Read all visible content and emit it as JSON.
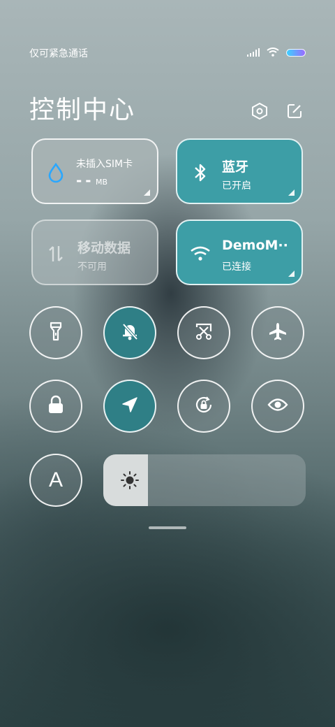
{
  "status_bar": {
    "carrier_text": "仅可紧急通话",
    "icons": [
      "signal-icon",
      "wifi-icon",
      "battery-icon"
    ]
  },
  "header": {
    "title": "控制中心",
    "actions": [
      "settings-icon",
      "edit-icon"
    ]
  },
  "tiles": {
    "data_usage": {
      "title": "未插入SIM卡",
      "value": "- -",
      "unit": "MB",
      "icon": "water-drop-icon"
    },
    "bluetooth": {
      "title": "蓝牙",
      "status": "已开启",
      "icon": "bluetooth-icon"
    },
    "mobile_data": {
      "title": "移动数据",
      "status": "不可用",
      "icon": "data-arrows-icon"
    },
    "wifi": {
      "title": "DemoM··",
      "status": "已连接",
      "icon": "wifi-icon"
    }
  },
  "toggles": [
    {
      "name": "flashlight",
      "icon": "flashlight-icon",
      "state": "off"
    },
    {
      "name": "mute",
      "icon": "bell-off-icon",
      "state": "on"
    },
    {
      "name": "screenshot",
      "icon": "scissors-icon",
      "state": "off"
    },
    {
      "name": "airplane",
      "icon": "airplane-icon",
      "state": "off"
    },
    {
      "name": "lock",
      "icon": "lock-icon",
      "state": "off"
    },
    {
      "name": "location",
      "icon": "location-arrow-icon",
      "state": "on"
    },
    {
      "name": "rotation-lock",
      "icon": "rotation-lock-icon",
      "state": "off"
    },
    {
      "name": "reading-mode",
      "icon": "eye-icon",
      "state": "off"
    },
    {
      "name": "auto-brightness",
      "icon": "letter-a-icon",
      "label": "A",
      "state": "off"
    }
  ],
  "brightness": {
    "level_percent": 22,
    "icon": "sun-icon"
  },
  "colors": {
    "teal_on": "#3d9ea6",
    "teal_round": "#2f7f86",
    "drop": "#2aa7ff"
  }
}
